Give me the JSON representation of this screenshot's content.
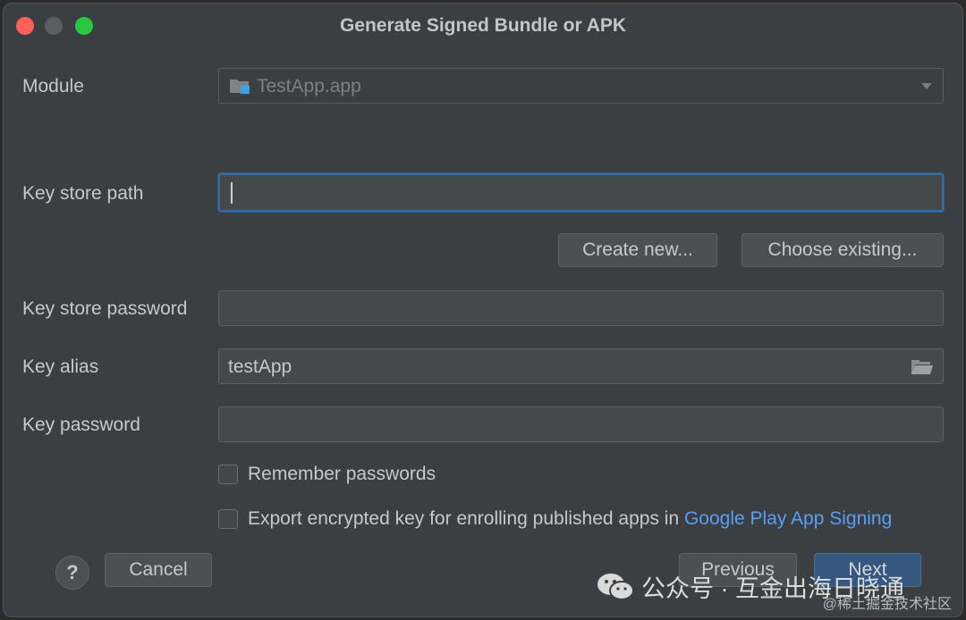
{
  "window": {
    "title": "Generate Signed Bundle or APK"
  },
  "module": {
    "label": "Module",
    "value": "TestApp.app",
    "icon": "module-folder-icon"
  },
  "key_store_path": {
    "label": "Key store path",
    "value": ""
  },
  "buttons": {
    "create_new": "Create new...",
    "choose_existing": "Choose existing..."
  },
  "key_store_password": {
    "label": "Key store password",
    "value": ""
  },
  "key_alias": {
    "label": "Key alias",
    "value": "testApp",
    "icon": "folder-open-icon"
  },
  "key_password": {
    "label": "Key password",
    "value": ""
  },
  "remember_passwords": {
    "label": "Remember passwords",
    "checked": false
  },
  "export_key": {
    "label": "Export encrypted key for enrolling published apps in ",
    "link": "Google Play App Signing",
    "checked": false
  },
  "footer": {
    "help": "?",
    "cancel": "Cancel",
    "previous": "Previous",
    "next": "Next"
  },
  "watermark": {
    "text": "公众号 · 互金出海日晓通",
    "sub": "@稀土掘金技术社区"
  },
  "colors": {
    "accent": "#3d6a99",
    "link": "#589df6",
    "primary_button": "#365880",
    "background": "#3c3f41"
  }
}
